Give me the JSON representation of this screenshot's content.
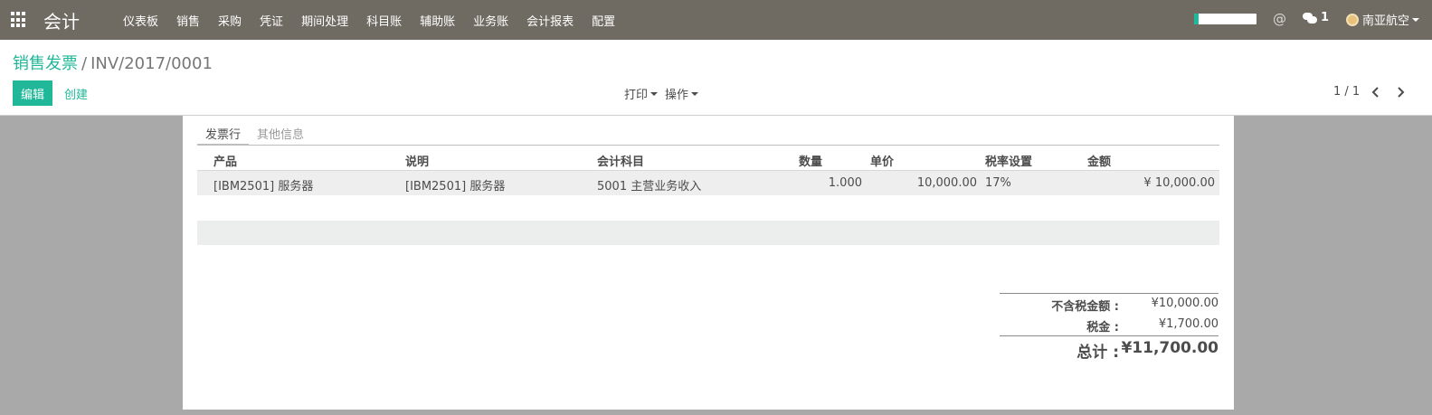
{
  "navbar": {
    "app_title": "会计",
    "menu": [
      "仪表板",
      "销售",
      "采购",
      "凭证",
      "期间处理",
      "科目账",
      "辅助账",
      "业务账",
      "会计报表",
      "配置"
    ],
    "progress_fraction": 0.07,
    "chat_count": "1",
    "user_name": "南亚航空",
    "icons": {
      "apps": "apps-grid-icon",
      "mention": "at-icon",
      "chat": "chat-icon",
      "user": "avatar"
    }
  },
  "control": {
    "breadcrumb_parent": "销售发票",
    "breadcrumb_sep": "/",
    "breadcrumb_current": "INV/2017/0001",
    "edit_label": "编辑",
    "create_label": "创建",
    "print_label": "打印",
    "action_label": "操作",
    "pager": "1 / 1"
  },
  "tabs": [
    "发票行",
    "其他信息"
  ],
  "table": {
    "headers": [
      "产品",
      "说明",
      "会计科目",
      "数量",
      "单价",
      "税率设置",
      "金额"
    ],
    "rows": [
      [
        "[IBM2501] 服务器",
        "[IBM2501] 服务器",
        "5001 主营业务收入",
        "1.000",
        "10,000.00",
        "17%",
        "¥ 10,000.00"
      ]
    ]
  },
  "totals": {
    "untaxed_label": "不含税金额 :",
    "untaxed_value": "¥10,000.00",
    "tax_label": "税金 :",
    "tax_value": "¥1,700.00",
    "total_label": "总计 :",
    "total_value": "¥11,700.00"
  },
  "colors": {
    "navbar": "#6f6a62",
    "accent": "#21b799",
    "sheet_bg": "#a9a9a9"
  }
}
